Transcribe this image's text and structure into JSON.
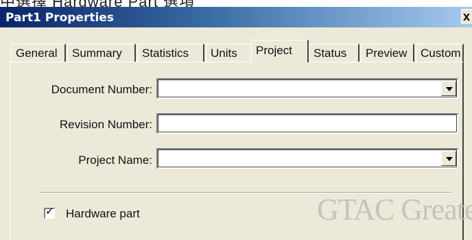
{
  "top_text": "中選擇 Hardware Part 選項",
  "window": {
    "title": "Part1 Properties",
    "close_label": "x"
  },
  "tabs": [
    {
      "label": "General"
    },
    {
      "label": "Summary"
    },
    {
      "label": "Statistics"
    },
    {
      "label": "Units"
    },
    {
      "label": "Project",
      "active": true
    },
    {
      "label": "Status"
    },
    {
      "label": "Preview"
    },
    {
      "label": "Custom"
    }
  ],
  "form": {
    "document_number": {
      "label": "Document Number:",
      "value": ""
    },
    "revision_number": {
      "label": "Revision Number:",
      "value": ""
    },
    "project_name": {
      "label": "Project Name:",
      "value": ""
    }
  },
  "hardware_part": {
    "label": "Hardware part",
    "checked": true,
    "check_glyph": "✓"
  },
  "watermark": "GTAC Greate"
}
